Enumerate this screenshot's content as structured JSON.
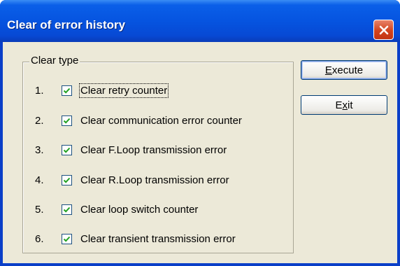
{
  "window": {
    "title": "Clear of error history"
  },
  "group": {
    "label": "Clear type"
  },
  "items": [
    {
      "num": "1.",
      "label": "Clear retry counter",
      "checked": true
    },
    {
      "num": "2.",
      "label": "Clear communication error counter",
      "checked": true
    },
    {
      "num": "3.",
      "label": "Clear F.Loop transmission error",
      "checked": true
    },
    {
      "num": "4.",
      "label": "Clear R.Loop transmission error",
      "checked": true
    },
    {
      "num": "5.",
      "label": "Clear loop switch counter",
      "checked": true
    },
    {
      "num": "6.",
      "label": "Clear transient transmission error",
      "checked": true
    }
  ],
  "buttons": {
    "execute": {
      "mnemonic": "E",
      "rest": "xecute"
    },
    "exit": {
      "pre": "E",
      "mnemonic": "x",
      "rest": "it"
    }
  },
  "colors": {
    "titlebar": "#0654e0",
    "close": "#d2431d",
    "dialog_bg": "#ece9d8"
  },
  "icons": {
    "close": "close-icon",
    "check": "check-icon"
  }
}
